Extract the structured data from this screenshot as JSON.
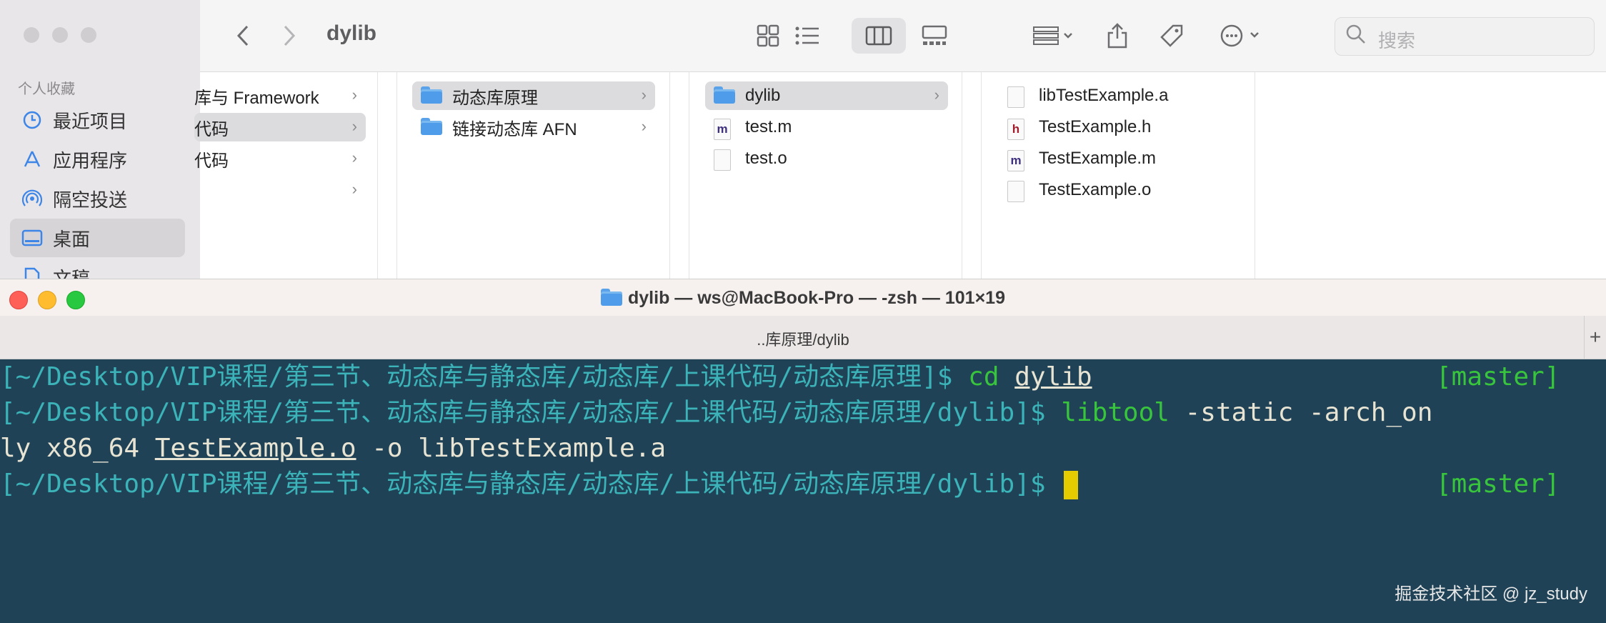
{
  "finder": {
    "title": "dylib",
    "sidebar": {
      "header": "个人收藏",
      "items": [
        {
          "label": "最近项目",
          "icon": "clock-icon"
        },
        {
          "label": "应用程序",
          "icon": "app-icon"
        },
        {
          "label": "隔空投送",
          "icon": "airdrop-icon"
        },
        {
          "label": "桌面",
          "icon": "desktop-icon"
        },
        {
          "label": "文稿",
          "icon": "document-icon"
        }
      ]
    },
    "search_placeholder": "搜索",
    "columns": [
      {
        "items": [
          "库与 Framework",
          "代码",
          "代码",
          ""
        ]
      },
      {
        "items": [
          "动态库原理",
          "链接动态库 AFN"
        ]
      },
      {
        "items": [
          "dylib",
          "test.m",
          "test.o"
        ]
      },
      {
        "items": [
          "libTestExample.a",
          "TestExample.h",
          "TestExample.m",
          "TestExample.o"
        ]
      }
    ]
  },
  "terminal": {
    "window_title": "dylib — ws@MacBook-Pro — -zsh — 101×19",
    "tab_title": "..库原理/dylib",
    "new_tab": "+",
    "lines": {
      "l1_prompt": "[~/Desktop/VIP课程/第三节、动态库与静态库/动态库/上课代码/动态库原理]$",
      "l1_cmd": "cd",
      "l1_arg": "dylib",
      "l1_branch": "[master]",
      "l2_prompt": "[~/Desktop/VIP课程/第三节、动态库与静态库/动态库/上课代码/动态库原理/dylib]$",
      "l2_cmd": "libtool",
      "l2_args": "-static -arch_on",
      "l3_a": "ly x86_64 ",
      "l3_file": "TestExample.o",
      "l3_b": " -o libTestExample.a",
      "l4_prompt": "[~/Desktop/VIP课程/第三节、动态库与静态库/动态库/上课代码/动态库原理/dylib]$",
      "l4_branch": "[master]"
    }
  },
  "watermark": "掘金技术社区 @ jz_study",
  "colors": {
    "terminal_bg": "#1f4256",
    "prompt_path": "#3bb3b8",
    "command_green": "#38c43c",
    "cursor": "#e5cc00",
    "folder_blue": "#4f9cea"
  }
}
